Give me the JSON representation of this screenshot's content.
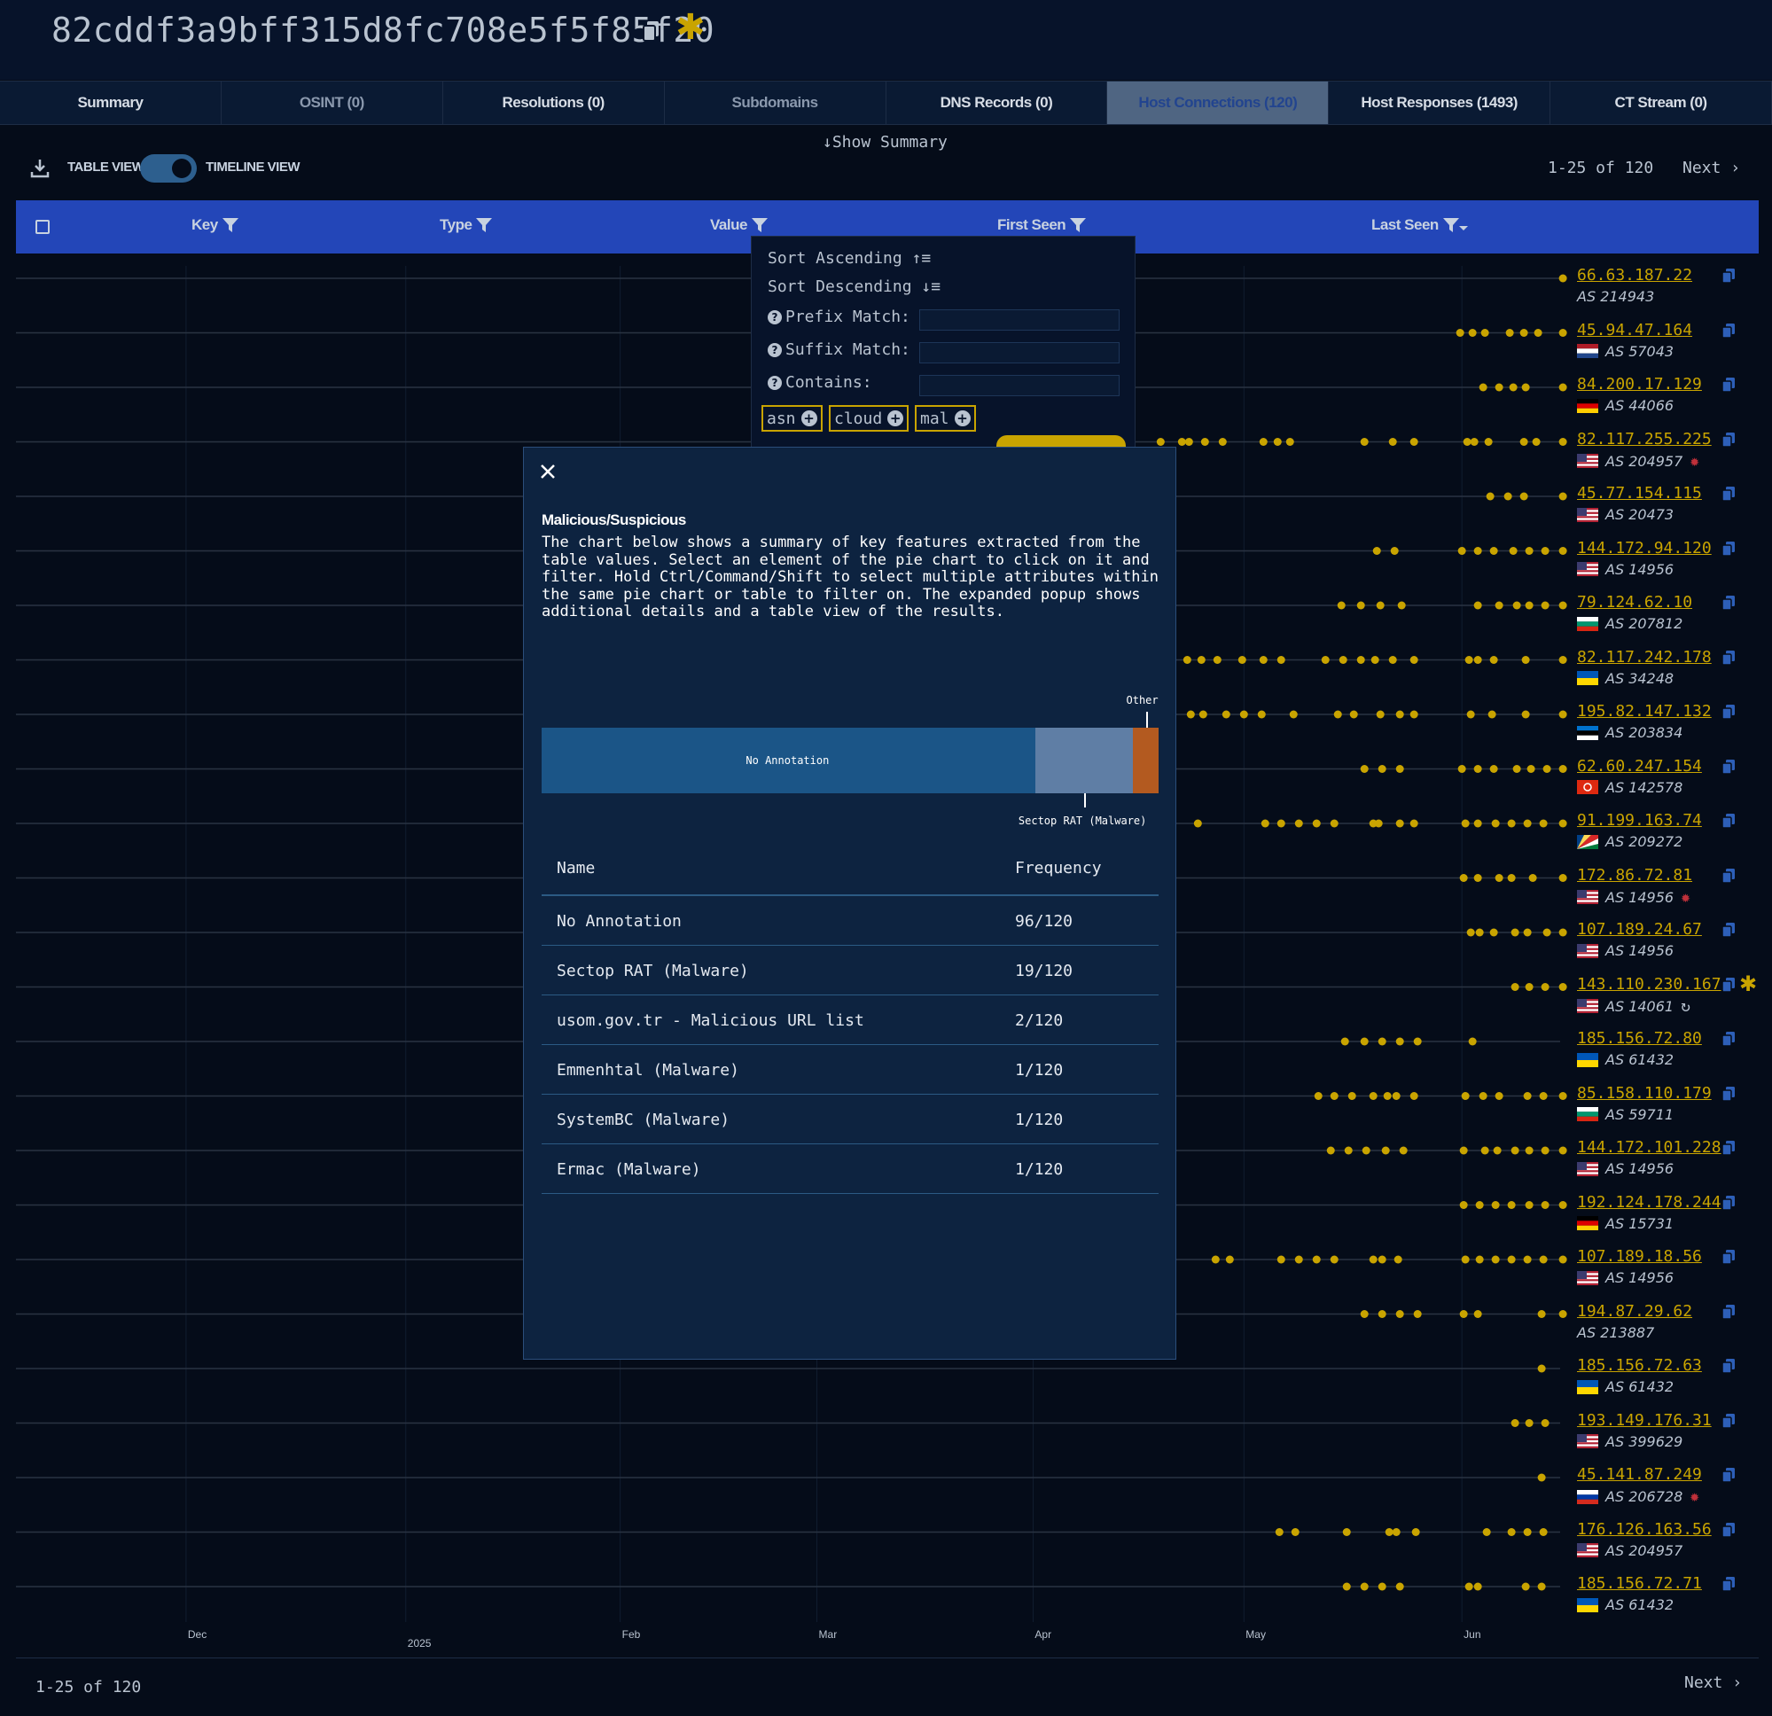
{
  "header": {
    "hash": "82cddf3a9bff315d8fc708e5f5f85f20"
  },
  "tabs": [
    {
      "label": "Summary",
      "state": "normal"
    },
    {
      "label": "OSINT (0)",
      "state": "muted"
    },
    {
      "label": "Resolutions (0)",
      "state": "normal"
    },
    {
      "label": "Subdomains",
      "state": "muted"
    },
    {
      "label": "DNS Records (0)",
      "state": "normal"
    },
    {
      "label": "Host Connections (120)",
      "state": "active"
    },
    {
      "label": "Host Responses (1493)",
      "state": "normal"
    },
    {
      "label": "CT Stream (0)",
      "state": "normal"
    }
  ],
  "toolbar": {
    "show_summary": "Show Summary",
    "table_view": "TABLE VIEW",
    "timeline_view": "TIMELINE VIEW",
    "pagination": "1-25 of 120",
    "next": "Next"
  },
  "table": {
    "columns": [
      "Key",
      "Type",
      "Value",
      "First Seen",
      "Last Seen"
    ]
  },
  "timeline": {
    "axis_labels": [
      "Dec",
      "2025",
      "Feb",
      "Mar",
      "Apr",
      "May",
      "Jun"
    ],
    "rows": [
      {
        "ip": "66.63.187.22",
        "as": "AS 214943",
        "flag": "none",
        "badge": "",
        "dots": [
          0.882
        ]
      },
      {
        "ip": "45.94.47.164",
        "as": "AS 57043",
        "flag": "nl",
        "badge": "",
        "dots": [
          0.824,
          0.831,
          0.838,
          0.852,
          0.86,
          0.868,
          0.882
        ]
      },
      {
        "ip": "84.200.17.129",
        "as": "AS 44066",
        "flag": "de",
        "badge": "",
        "dots": [
          0.837,
          0.846,
          0.854,
          0.861,
          0.882
        ]
      },
      {
        "ip": "82.117.255.225",
        "as": "AS 204957",
        "flag": "us",
        "badge": "malware",
        "dots": [
          0.655,
          0.667,
          0.671,
          0.68,
          0.69,
          0.713,
          0.721,
          0.728,
          0.77,
          0.786,
          0.798,
          0.828,
          0.832,
          0.84,
          0.86,
          0.867,
          0.882
        ]
      },
      {
        "ip": "45.77.154.115",
        "as": "AS 20473",
        "flag": "us",
        "badge": "",
        "dots": [
          0.841,
          0.851,
          0.86,
          0.882
        ]
      },
      {
        "ip": "144.172.94.120",
        "as": "AS 14956",
        "flag": "us",
        "badge": "",
        "dots": [
          0.777,
          0.787,
          0.825,
          0.834,
          0.843,
          0.854,
          0.863,
          0.872,
          0.882
        ]
      },
      {
        "ip": "79.124.62.10",
        "as": "AS 207812",
        "flag": "bg",
        "badge": "",
        "dots": [
          0.757,
          0.768,
          0.779,
          0.791,
          0.834,
          0.846,
          0.856,
          0.863,
          0.872,
          0.882
        ]
      },
      {
        "ip": "82.117.242.178",
        "as": "AS 34248",
        "flag": "ua",
        "badge": "",
        "dots": [
          0.67,
          0.678,
          0.687,
          0.701,
          0.713,
          0.723,
          0.748,
          0.758,
          0.768,
          0.776,
          0.786,
          0.798,
          0.829,
          0.834,
          0.843,
          0.861,
          0.882
        ]
      },
      {
        "ip": "195.82.147.132",
        "as": "AS 203834",
        "flag": "ee",
        "badge": "",
        "dots": [
          0.672,
          0.679,
          0.692,
          0.702,
          0.712,
          0.73,
          0.755,
          0.764,
          0.779,
          0.79,
          0.798,
          0.83,
          0.842,
          0.861,
          0.882
        ]
      },
      {
        "ip": "62.60.247.154",
        "as": "AS 142578",
        "flag": "hk",
        "badge": "",
        "dots": [
          0.77,
          0.78,
          0.79,
          0.825,
          0.834,
          0.843,
          0.856,
          0.864,
          0.873,
          0.882
        ]
      },
      {
        "ip": "91.199.163.74",
        "as": "AS 209272",
        "flag": "sc",
        "badge": "",
        "dots": [
          0.676,
          0.714,
          0.723,
          0.733,
          0.743,
          0.753,
          0.775,
          0.778,
          0.79,
          0.798,
          0.827,
          0.834,
          0.844,
          0.853,
          0.862,
          0.871,
          0.882
        ]
      },
      {
        "ip": "172.86.72.81",
        "as": "AS 14956",
        "flag": "us",
        "badge": "malware",
        "dots": [
          0.826,
          0.834,
          0.846,
          0.853,
          0.865,
          0.882
        ]
      },
      {
        "ip": "107.189.24.67",
        "as": "AS 14956",
        "flag": "us",
        "badge": "",
        "dots": [
          0.83,
          0.835,
          0.843,
          0.855,
          0.862,
          0.873,
          0.882
        ]
      },
      {
        "ip": "143.110.230.167",
        "as": "AS 14061",
        "flag": "us",
        "badge": "refresh",
        "star": true,
        "dots": [
          0.855,
          0.863,
          0.872,
          0.882
        ]
      },
      {
        "ip": "185.156.72.80",
        "as": "AS 61432",
        "flag": "ua",
        "badge": "",
        "dots": [
          0.759,
          0.77,
          0.78,
          0.79,
          0.8,
          0.831
        ]
      },
      {
        "ip": "85.158.110.179",
        "as": "AS 59711",
        "flag": "bg",
        "badge": "",
        "dots": [
          0.744,
          0.753,
          0.763,
          0.775,
          0.783,
          0.788,
          0.798,
          0.827,
          0.837,
          0.846,
          0.862,
          0.871,
          0.882
        ]
      },
      {
        "ip": "144.172.101.228",
        "as": "AS 14956",
        "flag": "us",
        "badge": "",
        "dots": [
          0.751,
          0.761,
          0.771,
          0.782,
          0.792,
          0.826,
          0.838,
          0.845,
          0.855,
          0.863,
          0.872,
          0.882
        ]
      },
      {
        "ip": "192.124.178.244",
        "as": "AS 15731",
        "flag": "de",
        "badge": "",
        "dots": [
          0.826,
          0.835,
          0.844,
          0.853,
          0.863,
          0.872,
          0.882
        ]
      },
      {
        "ip": "107.189.18.56",
        "as": "AS 14956",
        "flag": "us",
        "badge": "",
        "dots": [
          0.686,
          0.694,
          0.723,
          0.733,
          0.743,
          0.753,
          0.775,
          0.78,
          0.789,
          0.827,
          0.835,
          0.844,
          0.853,
          0.862,
          0.871,
          0.882
        ]
      },
      {
        "ip": "194.87.29.62",
        "as": "AS 213887",
        "flag": "none",
        "badge": "",
        "dots": [
          0.77,
          0.78,
          0.79,
          0.8,
          0.826,
          0.834,
          0.87,
          0.882
        ]
      },
      {
        "ip": "185.156.72.63",
        "as": "AS 61432",
        "flag": "ua",
        "badge": "",
        "dots": [
          0.87
        ]
      },
      {
        "ip": "193.149.176.31",
        "as": "AS 399629",
        "flag": "us",
        "badge": "",
        "dots": [
          0.855,
          0.863,
          0.872
        ]
      },
      {
        "ip": "45.141.87.249",
        "as": "AS 206728",
        "flag": "ru",
        "badge": "malware",
        "dots": [
          0.87
        ]
      },
      {
        "ip": "176.126.163.56",
        "as": "AS 204957",
        "flag": "us",
        "badge": "",
        "dots": [
          0.722,
          0.731,
          0.76,
          0.784,
          0.788,
          0.799,
          0.839,
          0.853,
          0.862,
          0.871
        ]
      },
      {
        "ip": "185.156.72.71",
        "as": "AS 61432",
        "flag": "ua",
        "badge": "",
        "dots": [
          0.76,
          0.77,
          0.78,
          0.79,
          0.829,
          0.834,
          0.861,
          0.87
        ]
      }
    ]
  },
  "dropdown": {
    "sort_asc": "Sort Ascending",
    "sort_desc": "Sort Descending",
    "prefix": "Prefix Match:",
    "suffix": "Suffix Match:",
    "contains": "Contains:",
    "chips": [
      "asn",
      "cloud",
      "mal"
    ]
  },
  "modal": {
    "title": "Malicious/Suspicious",
    "description": "The chart below shows a summary of key features extracted from the table values. Select an element of the pie chart to click on it and filter. Hold Ctrl/Command/Shift to select multiple attributes within the same pie chart or table to filter on. The expanded popup shows additional details and a table view of the results.",
    "table_headers": {
      "name": "Name",
      "frequency": "Frequency"
    },
    "rows": [
      {
        "name": "No Annotation",
        "frequency": "96/120"
      },
      {
        "name": "Sectop RAT (Malware)",
        "frequency": "19/120"
      },
      {
        "name": "usom.gov.tr - Malicious URL list",
        "frequency": "2/120"
      },
      {
        "name": "Emmenhtal (Malware)",
        "frequency": "1/120"
      },
      {
        "name": "SystemBC (Malware)",
        "frequency": "1/120"
      },
      {
        "name": "Ermac (Malware)",
        "frequency": "1/120"
      }
    ]
  },
  "chart_data": {
    "type": "bar",
    "orientation": "horizontal-stacked",
    "categories": [
      "No Annotation",
      "Sectop RAT (Malware)",
      "Other"
    ],
    "values": [
      96,
      19,
      5
    ],
    "colors": [
      "#1b5587",
      "#5f7ea5",
      "#b35a20"
    ]
  },
  "colors": {
    "background": "#050c19",
    "accent_yellow": "#c9a400",
    "header_blue": "#2346b8",
    "active_tab": "#4f6582"
  }
}
